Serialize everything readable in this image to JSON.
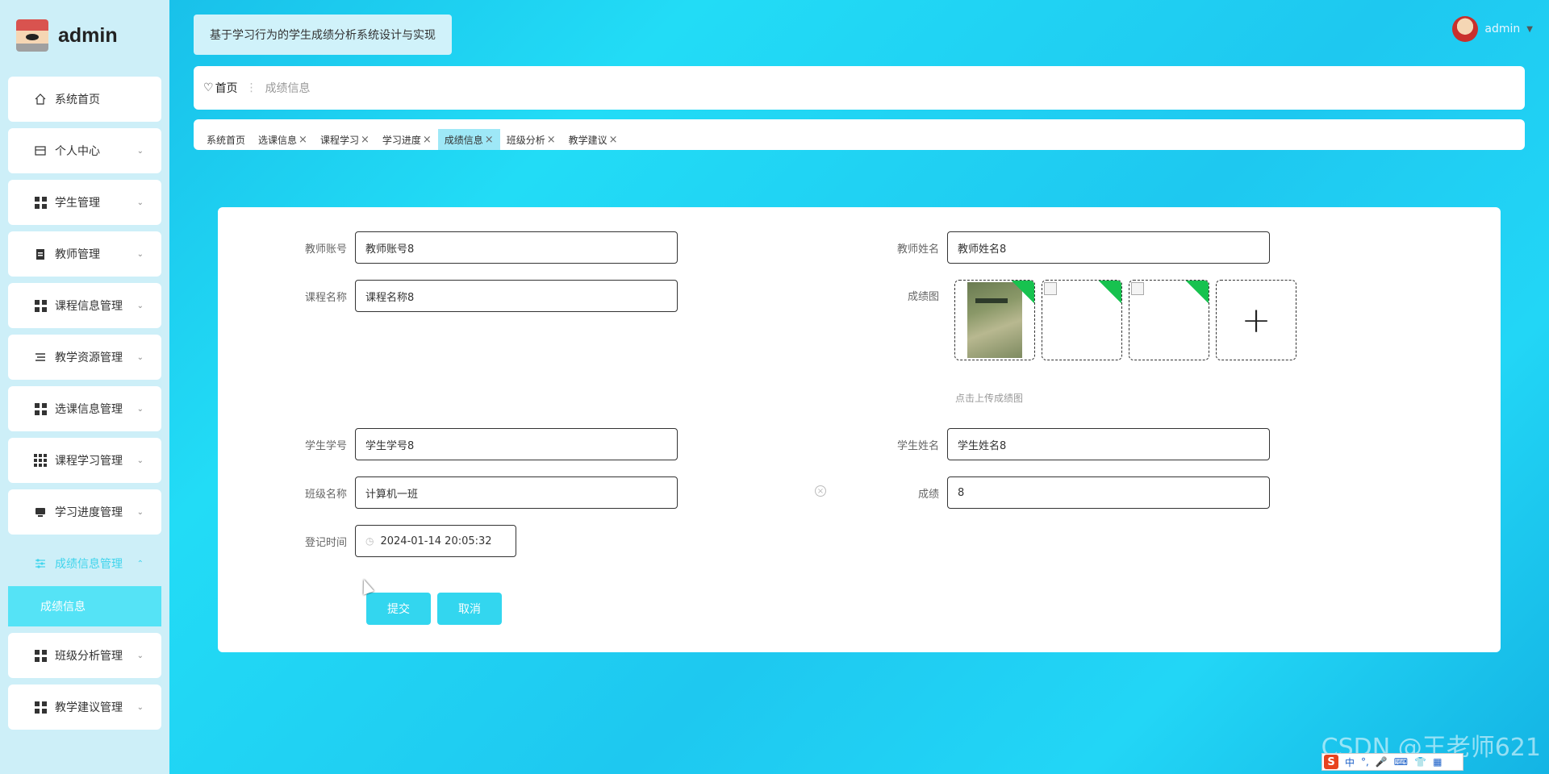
{
  "app": {
    "title": "基于学习行为的学生成绩分析系统设计与实现",
    "brand": "admin"
  },
  "user": {
    "name": "admin"
  },
  "sidebar": {
    "items": [
      {
        "label": "系统首页",
        "icon": "home-icon"
      },
      {
        "label": "个人中心",
        "icon": "card-icon"
      },
      {
        "label": "学生管理",
        "icon": "grid-icon"
      },
      {
        "label": "教师管理",
        "icon": "clipboard-icon"
      },
      {
        "label": "课程信息管理",
        "icon": "grid-icon"
      },
      {
        "label": "教学资源管理",
        "icon": "list-icon"
      },
      {
        "label": "选课信息管理",
        "icon": "grid-icon"
      },
      {
        "label": "课程学习管理",
        "icon": "grid9-icon"
      },
      {
        "label": "学习进度管理",
        "icon": "monitor-icon"
      },
      {
        "label": "成绩信息管理",
        "icon": "sliders-icon"
      },
      {
        "label": "班级分析管理",
        "icon": "grid-icon"
      },
      {
        "label": "教学建议管理",
        "icon": "grid-icon"
      }
    ],
    "sub_item": "成绩信息"
  },
  "breadcrumb": {
    "home": "首页",
    "current": "成绩信息"
  },
  "tabs": [
    "系统首页",
    "选课信息",
    "课程学习",
    "学习进度",
    "成绩信息",
    "班级分析",
    "教学建议"
  ],
  "form": {
    "teacher_account": {
      "label": "教师账号",
      "value": "教师账号8"
    },
    "teacher_name": {
      "label": "教师姓名",
      "value": "教师姓名8"
    },
    "course_name": {
      "label": "课程名称",
      "value": "课程名称8"
    },
    "score_image": {
      "label": "成绩图",
      "hint": "点击上传成绩图"
    },
    "student_id": {
      "label": "学生学号",
      "value": "学生学号8"
    },
    "student_name": {
      "label": "学生姓名",
      "value": "学生姓名8"
    },
    "class_name": {
      "label": "班级名称",
      "value": "计算机一班"
    },
    "score": {
      "label": "成绩",
      "value": "8"
    },
    "register_time": {
      "label": "登记时间",
      "value": "2024-01-14 20:05:32"
    },
    "submit": "提交",
    "cancel": "取消"
  },
  "watermark": "CSDN @王老师621",
  "ime": {
    "logo": "S",
    "mode": "中"
  },
  "colors": {
    "accent": "#33d6ef",
    "upload_badge": "#17c24f",
    "sidebar_bg": "#cdeff8"
  }
}
